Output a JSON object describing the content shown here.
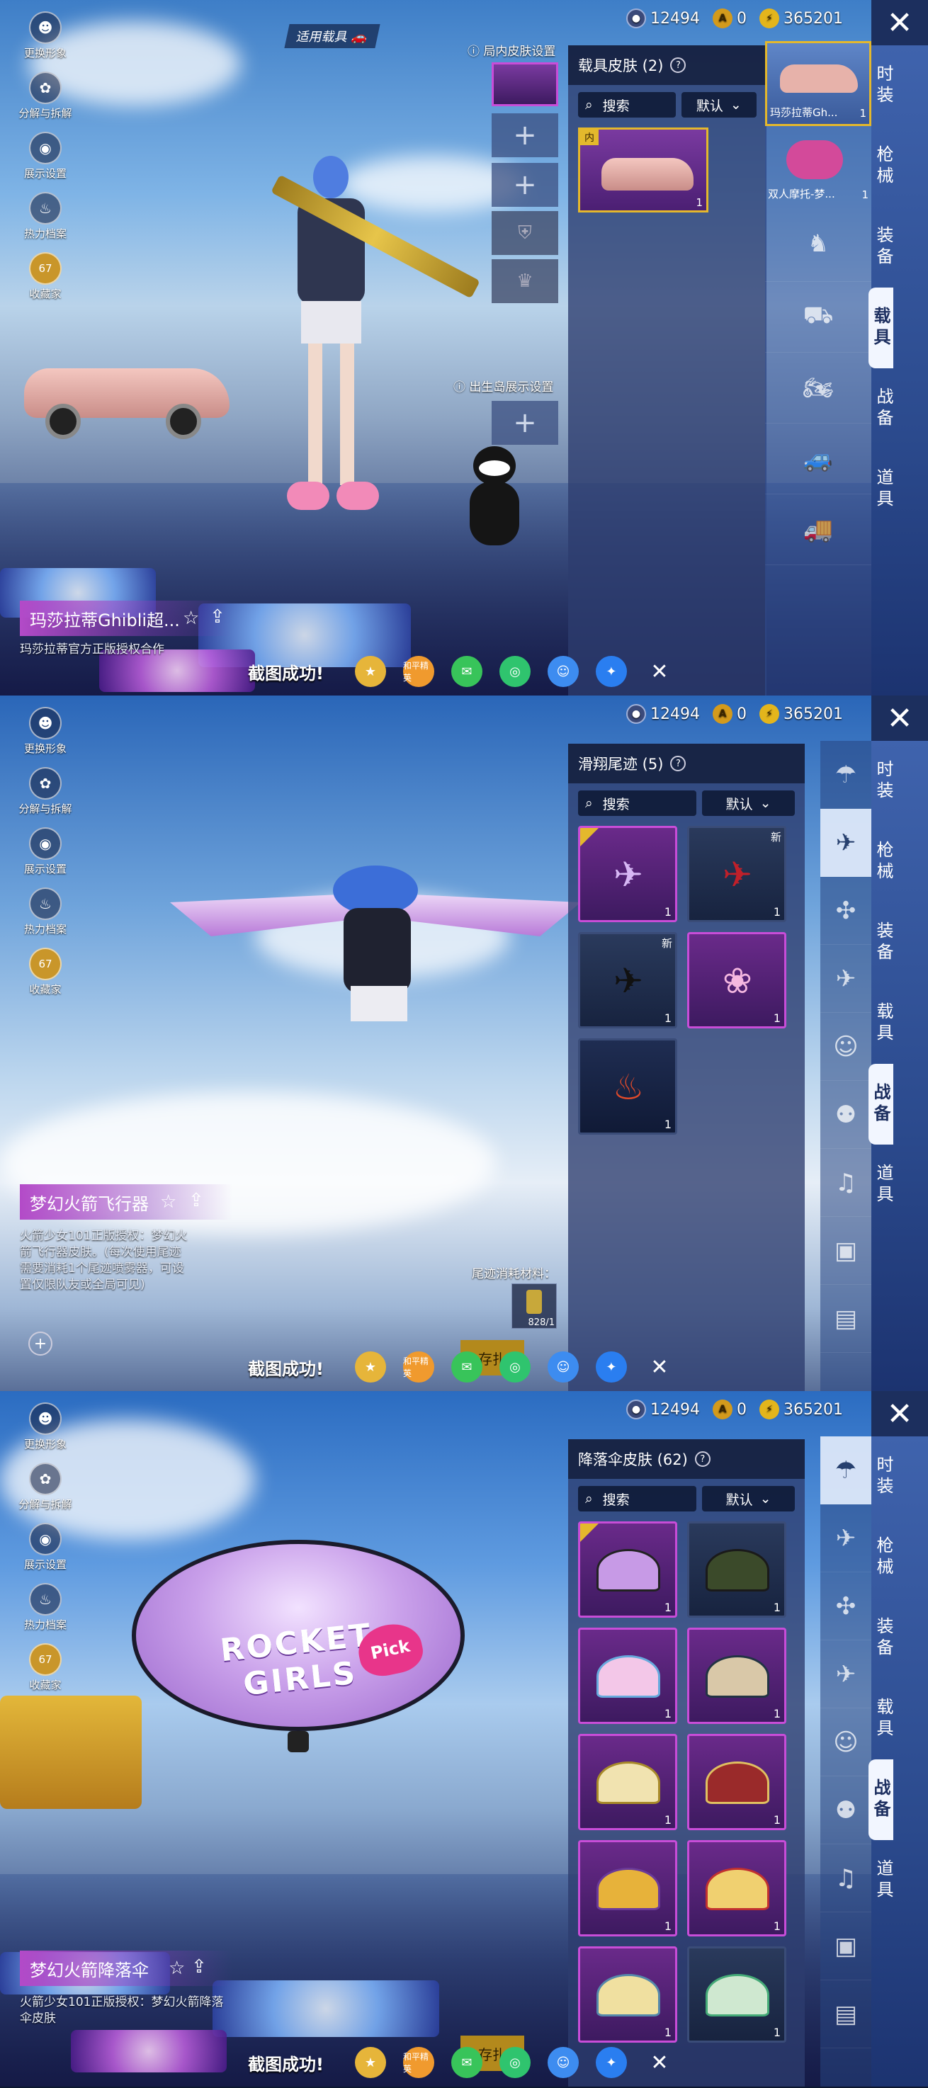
{
  "common": {
    "sidebar": [
      {
        "label": "更换形象",
        "icon": "avatar-icon"
      },
      {
        "label": "分解与拆解",
        "icon": "gear-icon"
      },
      {
        "label": "展示设置",
        "icon": "eye-icon"
      },
      {
        "label": "热力档案",
        "icon": "flame-icon"
      },
      {
        "label": "收藏家",
        "icon": "badge-icon",
        "badge": "67"
      }
    ],
    "currency": {
      "c1": "12494",
      "c2": "0",
      "c3": "365201"
    },
    "categories": [
      "时装",
      "枪械",
      "装备",
      "载具",
      "战备",
      "道具"
    ],
    "toast": "截图成功!",
    "share": {
      "s2": "和平精英"
    },
    "search": "搜索",
    "sort": "默认",
    "item_count": "1"
  },
  "p1": {
    "applicable_label": "适用载具",
    "inner_skin_setting": "局内皮肤设置",
    "spawn_setting": "出生岛展示设置",
    "panel_title": "载具皮肤 (2)",
    "selected_tag": "内",
    "right_items": [
      {
        "label": "玛莎拉蒂Gh...",
        "count": "1"
      },
      {
        "label": "双人摩托-梦...",
        "count": "1"
      }
    ],
    "item_name": "玛莎拉蒂Ghibli超...",
    "item_desc": "玛莎拉蒂官方正版授权合作"
  },
  "p2": {
    "panel_title": "滑翔尾迹 (5)",
    "new_tag": "新",
    "item_name": "梦幻火箭飞行器",
    "item_desc": "火箭少女101正版授权：梦幻火箭飞行器皮肤。(每次使用尾迹需要消耗1个尾迹喷雾器，可设置仅限队友或全局可见)",
    "material_label": "尾迹消耗材料：",
    "material_count": "828/1",
    "btn_partial": "存扎"
  },
  "p3": {
    "panel_title": "降落伞皮肤 (62)",
    "item_name": "梦幻火箭降落伞",
    "item_desc": "火箭少女101正版授权：梦幻火箭降落伞皮肤",
    "btn_partial": "存扎",
    "parachute_text": "ROCKET GIRLS",
    "pick_text": "Pick"
  },
  "colors": {
    "accent": "#c84dd8",
    "gold": "#e4b82c",
    "panel": "#2b4a8d"
  }
}
